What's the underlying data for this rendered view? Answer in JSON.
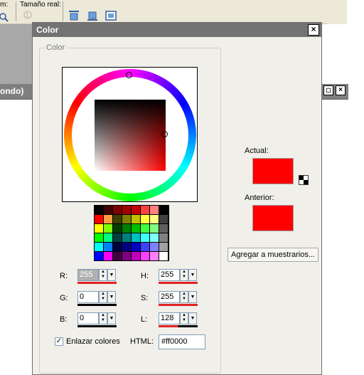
{
  "background_app": {
    "labels": [
      "m:",
      "Tamaño real:"
    ],
    "window_title": "ondo)",
    "close_glyph": "×"
  },
  "dialog": {
    "title": "Color",
    "close_glyph": "×",
    "group_label": "Color",
    "current_color_label": "Actual:",
    "previous_color_label": "Anterior:",
    "add_to_swatches_button": "Agregar a muestrarios...",
    "current_color": "#ff0000",
    "previous_color": "#ff0000",
    "link_colors_label": "Enlazar colores",
    "link_colors_checked": true,
    "html_label": "HTML:",
    "html_value": "#ff0000",
    "fields": {
      "r": {
        "label": "R:",
        "value": "255"
      },
      "g": {
        "label": "G:",
        "value": "0"
      },
      "b": {
        "label": "B:",
        "value": "0"
      },
      "h": {
        "label": "H:",
        "value": "255"
      },
      "s": {
        "label": "S:",
        "value": "255"
      },
      "l": {
        "label": "L:",
        "value": "128"
      }
    },
    "swatch_colors": [
      [
        "#000000",
        "#400000",
        "#800000",
        "#a00000",
        "#c00000",
        "#ff4040",
        "#ff8080",
        "#000000"
      ],
      [
        "#ff0000",
        "#ffa040",
        "#404000",
        "#808000",
        "#c0c000",
        "#ffff40",
        "#ffff80",
        "#404040"
      ],
      [
        "#ffff00",
        "#80ff00",
        "#004000",
        "#008000",
        "#00c000",
        "#40ff40",
        "#80ff80",
        "#606060"
      ],
      [
        "#00ff00",
        "#00ff80",
        "#004040",
        "#008080",
        "#00c0c0",
        "#40ffff",
        "#80ffff",
        "#808080"
      ],
      [
        "#00ffff",
        "#0080ff",
        "#000040",
        "#000080",
        "#0000c0",
        "#4040ff",
        "#8080ff",
        "#a0a0a0"
      ],
      [
        "#0000ff",
        "#ff00ff",
        "#400040",
        "#800080",
        "#c000c0",
        "#ff40ff",
        "#ff80ff",
        "#ffffff"
      ]
    ]
  }
}
